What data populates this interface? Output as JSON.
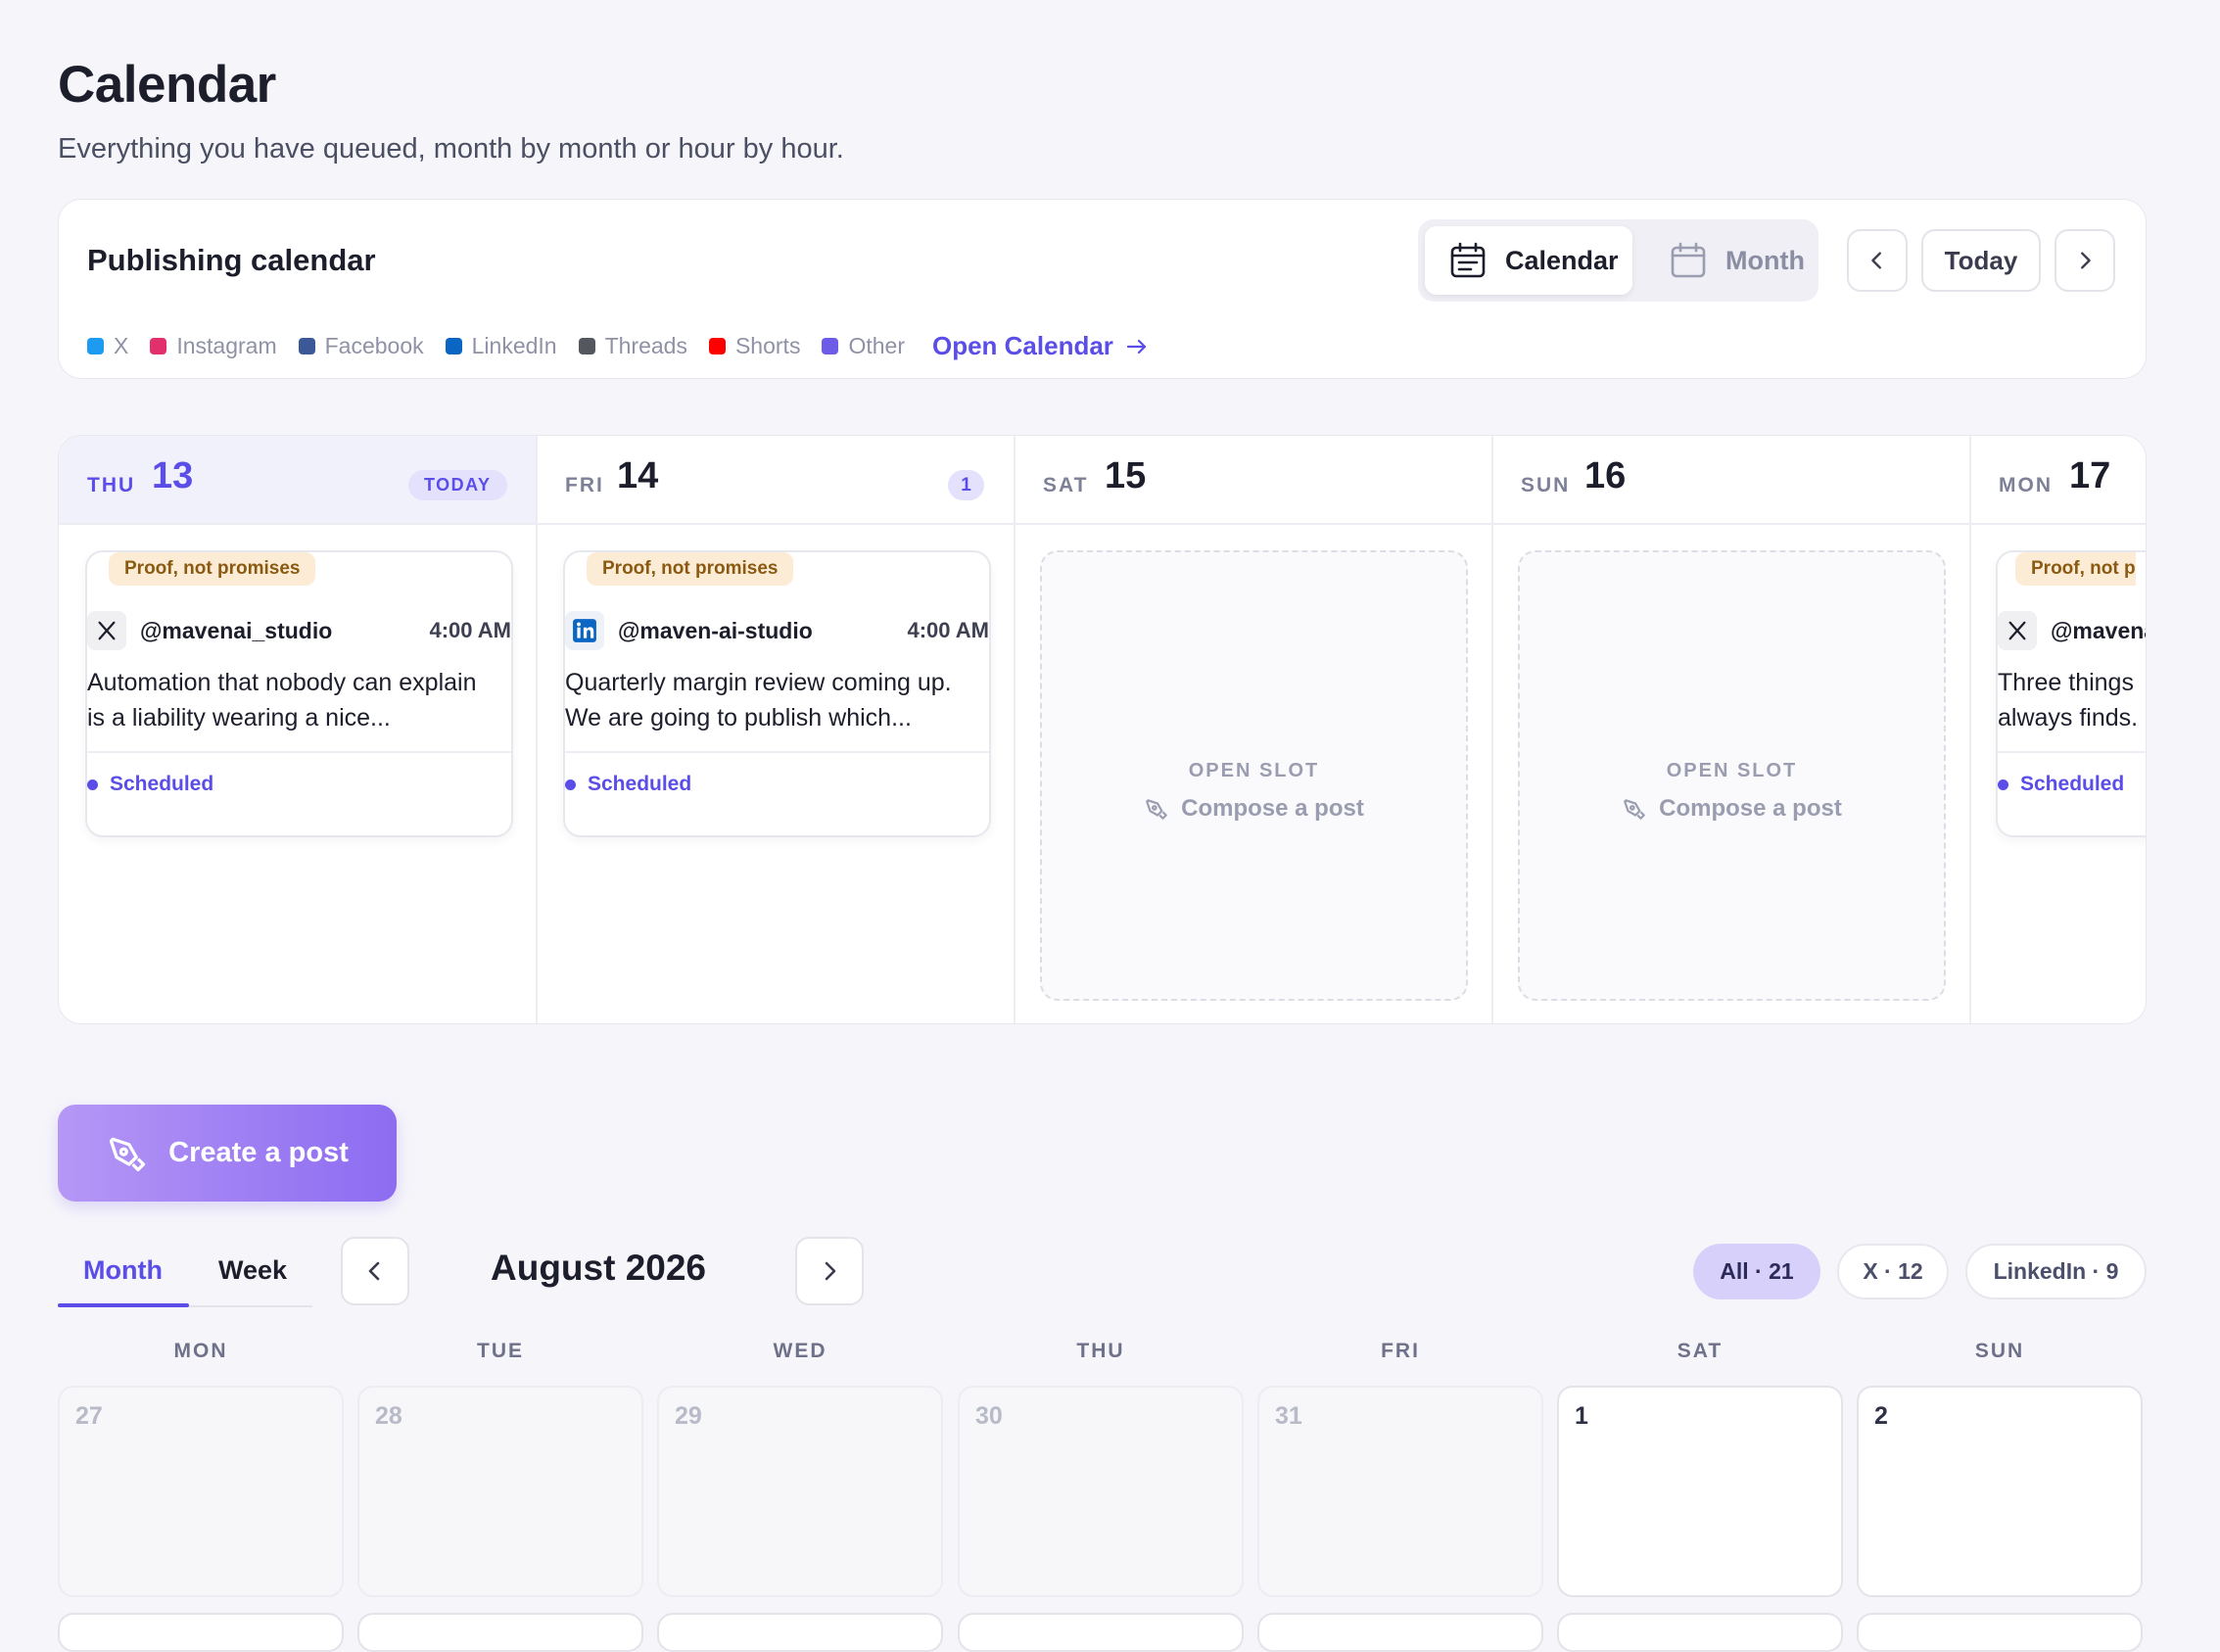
{
  "header": {
    "title": "Calendar",
    "subtitle": "Everything you have queued, month by month or hour by hour."
  },
  "publishing": {
    "title": "Publishing calendar",
    "view_toggle": {
      "calendar": "Calendar",
      "month": "Month"
    },
    "nav": {
      "today": "Today"
    },
    "legend": [
      {
        "label": "X",
        "color": "#1d9bf0"
      },
      {
        "label": "Instagram",
        "color": "#e1306c"
      },
      {
        "label": "Facebook",
        "color": "#3b5998"
      },
      {
        "label": "LinkedIn",
        "color": "#0a66c2"
      },
      {
        "label": "Threads",
        "color": "#55575f"
      },
      {
        "label": "Shorts",
        "color": "#ff0000"
      },
      {
        "label": "Other",
        "color": "#6c5ce7"
      }
    ],
    "open_calendar": "Open Calendar"
  },
  "week": {
    "days": [
      {
        "dow": "THU",
        "num": "13",
        "badge": "TODAY"
      },
      {
        "dow": "FRI",
        "num": "14",
        "badge": "1"
      },
      {
        "dow": "SAT",
        "num": "15"
      },
      {
        "dow": "SUN",
        "num": "16"
      },
      {
        "dow": "MON",
        "num": "17"
      }
    ],
    "posts": [
      {
        "campaign": "Proof, not promises",
        "handle": "@mavenai_studio",
        "network": "x-icon",
        "time": "4:00 AM",
        "text": "Automation that nobody can explain is a liability wearing a nice...",
        "status": "Scheduled"
      },
      {
        "campaign": "Proof, not promises",
        "handle": "@maven-ai-studio",
        "network": "linkedin-icon",
        "time": "4:00 AM",
        "text": "Quarterly margin review coming up. We are going to publish which...",
        "status": "Scheduled"
      },
      {
        "campaign": "Proof, not p",
        "handle": "@mavena",
        "network": "x-icon",
        "text": "Three things always finds.",
        "status": "Scheduled"
      }
    ],
    "open_slot": {
      "label": "OPEN SLOT",
      "action": "Compose a post"
    }
  },
  "create_post": "Create a post",
  "month_view": {
    "tabs": [
      "Month",
      "Week"
    ],
    "title": "August 2026",
    "filters": [
      "All · 21",
      "X · 12",
      "LinkedIn · 9"
    ],
    "weekdays": [
      "MON",
      "TUE",
      "WED",
      "THU",
      "FRI",
      "SAT",
      "SUN"
    ],
    "cells": [
      "27",
      "28",
      "29",
      "30",
      "31",
      "1",
      "2"
    ]
  },
  "colors": {
    "accent": "#5a4de8",
    "campaign_tag_bg": "#fcecd6"
  }
}
